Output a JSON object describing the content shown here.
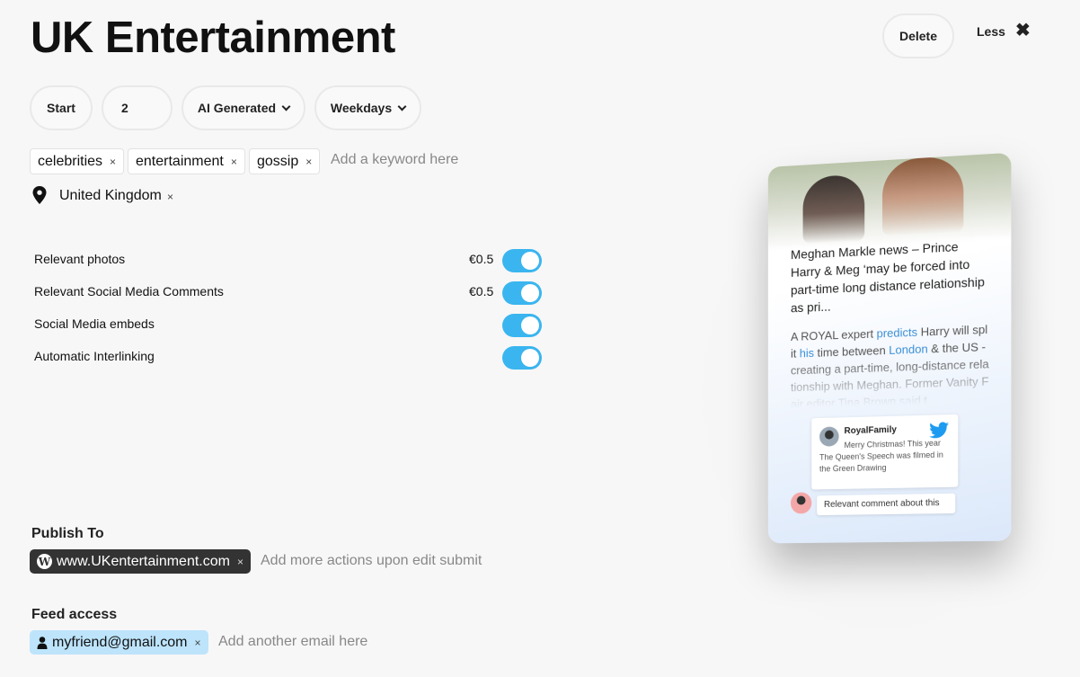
{
  "title": "UK Entertainment",
  "header": {
    "delete_label": "Delete",
    "less_label": "Less",
    "close_glyph": "✖"
  },
  "filters": {
    "start_label": "Start",
    "count_value": "2",
    "mode_label": "AI Generated",
    "schedule_label": "Weekdays"
  },
  "keywords": {
    "items": [
      "celebrities",
      "entertainment",
      "gossip"
    ],
    "remove_glyph": "×",
    "placeholder": "Add a keyword here"
  },
  "location": {
    "label": "United Kingdom",
    "remove_glyph": "×"
  },
  "options": [
    {
      "label": "Relevant photos",
      "price": "€0.5",
      "enabled": true
    },
    {
      "label": "Relevant Social Media Comments",
      "price": "€0.5",
      "enabled": true
    },
    {
      "label": "Social Media embeds",
      "price": "",
      "enabled": true
    },
    {
      "label": "Automatic Interlinking",
      "price": "",
      "enabled": true
    }
  ],
  "publish": {
    "heading": "Publish To",
    "site": "www.UKentertainment.com",
    "remove_glyph": "×",
    "placeholder": "Add more actions upon edit submit"
  },
  "feed": {
    "heading": "Feed access",
    "email": "myfriend@gmail.com",
    "remove_glyph": "×",
    "placeholder": "Add another email here"
  },
  "preview": {
    "article_title": "Meghan Markle news – Prince Harry & Meg ‘may be forced into part-time long distance relationship as pri...",
    "body_parts": [
      "A ROYAL expert ",
      "predicts",
      " Harry will split ",
      "his",
      " time between ",
      "London",
      " & the US - creating a part-time, long-distance relationship with Meghan. Former Vanity Fair editor Tina Brown said t"
    ],
    "tweet_author": "RoyalFamily",
    "tweet_text": "Merry Christmas! This year The Queen's Speech was filmed in the Green Drawing",
    "comment": "Relevant comment about this"
  },
  "colors": {
    "toggle_on": "#3ab5ef",
    "link": "#3a8fd6",
    "email_chip": "#bde4fb",
    "dark_chip": "#333333"
  }
}
